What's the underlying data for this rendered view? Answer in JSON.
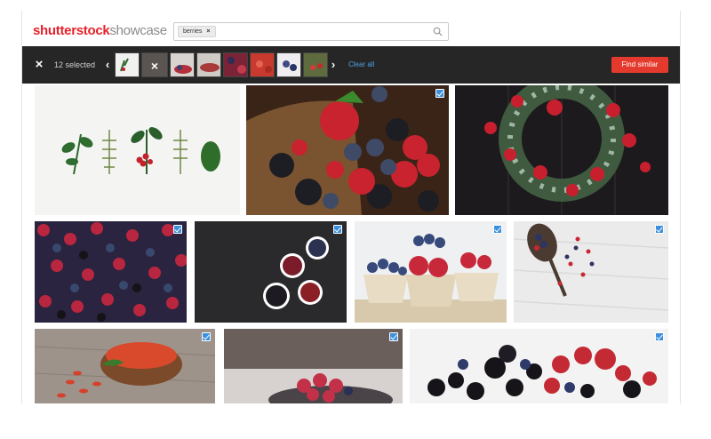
{
  "header": {
    "logo_brand": "shutterstock",
    "logo_suffix": "showcase",
    "search": {
      "chip_label": "berries",
      "chip_remove": "×"
    }
  },
  "selection_bar": {
    "close": "×",
    "count_label": "12 selected",
    "prev": "‹",
    "next": "›",
    "active_thumb_remove": "×",
    "clear_all_label": "Clear all",
    "find_similar_label": "Find similar"
  },
  "colors": {
    "brand_red": "#e8222b",
    "bar_background": "#262626",
    "link_blue": "#4aa3e8",
    "button_red": "#e43a2d",
    "check_blue": "#3b8fde"
  },
  "icons": [
    "search-icon",
    "close-icon",
    "chevron-left-icon",
    "chevron-right-icon",
    "checkbox-checked-icon"
  ]
}
